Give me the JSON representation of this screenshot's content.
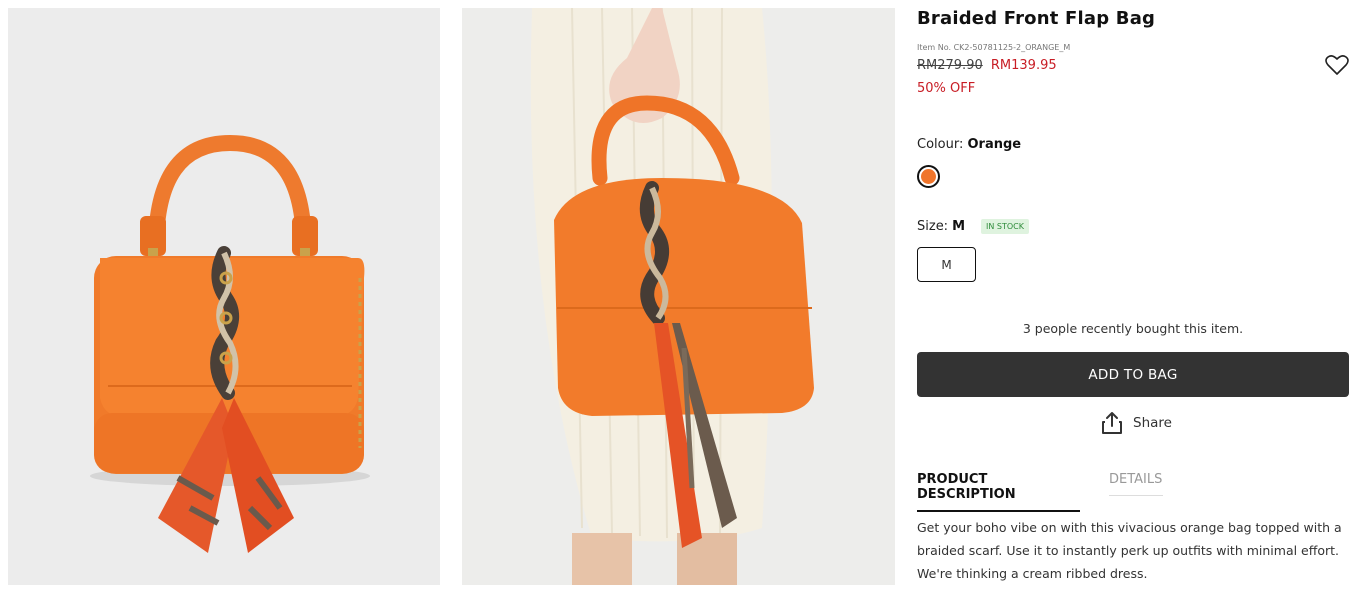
{
  "images": [
    {
      "name": "product-image-front",
      "alt": "Braided Front Flap Bag - front view"
    },
    {
      "name": "product-image-model",
      "alt": "Braided Front Flap Bag - held by model"
    }
  ],
  "product": {
    "title": "Braided Front Flap Bag",
    "item_no": "Item No. CK2-50781125-2_ORANGE_M",
    "old_price": "RM279.90",
    "new_price": "RM139.95",
    "discount": "50% OFF"
  },
  "colour": {
    "label": "Colour:",
    "value": "Orange",
    "swatch_color": "#f0752b"
  },
  "size": {
    "label": "Size:",
    "value": "M",
    "stock": "IN STOCK",
    "option": "M"
  },
  "social_proof": "3 people recently bought this item.",
  "actions": {
    "add_to_bag": "ADD TO BAG",
    "share": "Share"
  },
  "tabs": [
    {
      "label": "PRODUCT DESCRIPTION",
      "active": true
    },
    {
      "label": "DETAILS",
      "active": false
    }
  ],
  "description": "Get your boho vibe on with this vivacious orange bag topped with a braided scarf. Use it to instantly perk up outfits with minimal effort. We're thinking a cream ribbed dress.",
  "icons": {
    "wishlist": "heart-icon",
    "share": "share-icon"
  },
  "colors": {
    "accent_red": "#c81d25",
    "button_dark": "#333333",
    "stock_green": "#2e8b3a"
  }
}
